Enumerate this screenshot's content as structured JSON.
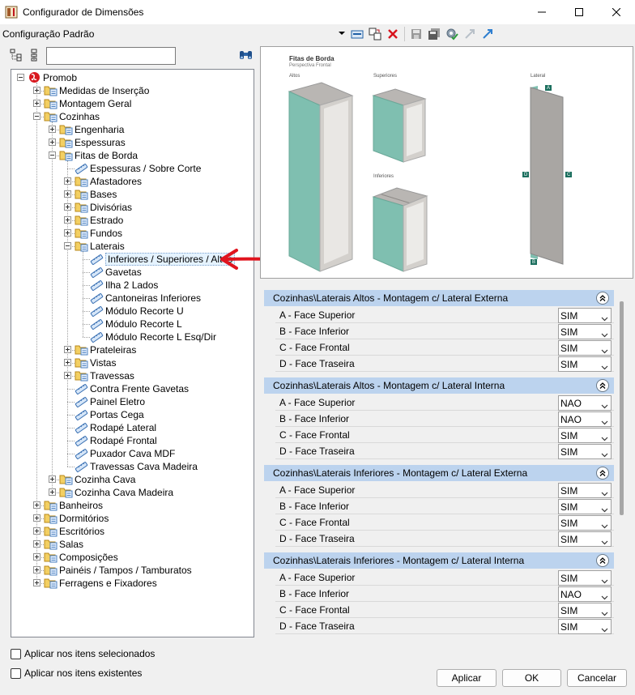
{
  "window": {
    "title": "Configurador de Dimensões"
  },
  "toolbar": {
    "config_value": "Configuração Padrão"
  },
  "tree": {
    "nodes": [
      {
        "label": "Promob",
        "level": 0,
        "expander": "minus",
        "icon": "globe-icon"
      },
      {
        "label": "Medidas de Inserção",
        "level": 1,
        "expander": "plus",
        "icon": "folder-icon"
      },
      {
        "label": "Montagem Geral",
        "level": 1,
        "expander": "plus",
        "icon": "folder-icon"
      },
      {
        "label": "Cozinhas",
        "level": 1,
        "expander": "minus",
        "icon": "folder-icon"
      },
      {
        "label": "Engenharia",
        "level": 2,
        "expander": "plus",
        "icon": "folder-icon"
      },
      {
        "label": "Espessuras",
        "level": 2,
        "expander": "plus",
        "icon": "folder-icon"
      },
      {
        "label": "Fitas de Borda",
        "level": 2,
        "expander": "minus",
        "icon": "folder-icon"
      },
      {
        "label": "Espessuras / Sobre Corte",
        "level": 3,
        "expander": "none",
        "icon": "ruler-icon"
      },
      {
        "label": "Afastadores",
        "level": 3,
        "expander": "plus",
        "icon": "folder-icon"
      },
      {
        "label": "Bases",
        "level": 3,
        "expander": "plus",
        "icon": "folder-icon"
      },
      {
        "label": "Divisórias",
        "level": 3,
        "expander": "plus",
        "icon": "folder-icon"
      },
      {
        "label": "Estrado",
        "level": 3,
        "expander": "plus",
        "icon": "folder-icon"
      },
      {
        "label": "Fundos",
        "level": 3,
        "expander": "plus",
        "icon": "folder-icon"
      },
      {
        "label": "Laterais",
        "level": 3,
        "expander": "minus",
        "icon": "folder-icon"
      },
      {
        "label": "Inferiores / Superiores / Altos",
        "level": 4,
        "expander": "none",
        "icon": "ruler-icon",
        "selected": true
      },
      {
        "label": "Gavetas",
        "level": 4,
        "expander": "none",
        "icon": "ruler-icon"
      },
      {
        "label": "Ilha 2 Lados",
        "level": 4,
        "expander": "none",
        "icon": "ruler-icon"
      },
      {
        "label": "Cantoneiras Inferiores",
        "level": 4,
        "expander": "none",
        "icon": "ruler-icon"
      },
      {
        "label": "Módulo Recorte U",
        "level": 4,
        "expander": "none",
        "icon": "ruler-icon"
      },
      {
        "label": "Módulo Recorte L",
        "level": 4,
        "expander": "none",
        "icon": "ruler-icon"
      },
      {
        "label": "Módulo Recorte L Esq/Dir",
        "level": 4,
        "expander": "none",
        "icon": "ruler-icon"
      },
      {
        "label": "Prateleiras",
        "level": 3,
        "expander": "plus",
        "icon": "folder-icon"
      },
      {
        "label": "Vistas",
        "level": 3,
        "expander": "plus",
        "icon": "folder-icon"
      },
      {
        "label": "Travessas",
        "level": 3,
        "expander": "plus",
        "icon": "folder-icon"
      },
      {
        "label": "Contra Frente Gavetas",
        "level": 3,
        "expander": "none",
        "icon": "ruler-icon"
      },
      {
        "label": "Painel Eletro",
        "level": 3,
        "expander": "none",
        "icon": "ruler-icon"
      },
      {
        "label": "Portas Cega",
        "level": 3,
        "expander": "none",
        "icon": "ruler-icon"
      },
      {
        "label": "Rodapé Lateral",
        "level": 3,
        "expander": "none",
        "icon": "ruler-icon"
      },
      {
        "label": "Rodapé Frontal",
        "level": 3,
        "expander": "none",
        "icon": "ruler-icon"
      },
      {
        "label": "Puxador Cava MDF",
        "level": 3,
        "expander": "none",
        "icon": "ruler-icon"
      },
      {
        "label": "Travessas Cava Madeira",
        "level": 3,
        "expander": "none",
        "icon": "ruler-icon"
      },
      {
        "label": "Cozinha Cava",
        "level": 2,
        "expander": "plus",
        "icon": "folder-icon"
      },
      {
        "label": "Cozinha Cava Madeira",
        "level": 2,
        "expander": "plus",
        "icon": "folder-icon"
      },
      {
        "label": "Banheiros",
        "level": 1,
        "expander": "plus",
        "icon": "folder-icon"
      },
      {
        "label": "Dormitórios",
        "level": 1,
        "expander": "plus",
        "icon": "folder-icon"
      },
      {
        "label": "Escritórios",
        "level": 1,
        "expander": "plus",
        "icon": "folder-icon"
      },
      {
        "label": "Salas",
        "level": 1,
        "expander": "plus",
        "icon": "folder-icon"
      },
      {
        "label": "Composições",
        "level": 1,
        "expander": "plus",
        "icon": "folder-icon"
      },
      {
        "label": "Painéis / Tampos / Tamburatos",
        "level": 1,
        "expander": "plus",
        "icon": "folder-icon"
      },
      {
        "label": "Ferragens e Fixadores",
        "level": 1,
        "expander": "plus",
        "icon": "folder-icon"
      }
    ]
  },
  "preview": {
    "title": "Fitas de Borda",
    "subtitle": "Perspectiva Frontal",
    "label_altos": "Altos",
    "label_superiores": "Superiores",
    "label_inferiores": "Inferiores",
    "label_lateral": "Lateral",
    "edge_a": "A",
    "edge_b": "B",
    "edge_c": "C",
    "edge_d": "D",
    "colors": {
      "edge_band": "#7fbfb0",
      "panel": "#c9c6c3",
      "badge": "#1b6f5e"
    }
  },
  "groups": [
    {
      "title": "Cozinhas\\Laterais Altos - Montagem c/ Lateral Externa",
      "rows": [
        {
          "label": "A - Face Superior",
          "value": "SIM"
        },
        {
          "label": "B - Face Inferior",
          "value": "SIM"
        },
        {
          "label": "C - Face Frontal",
          "value": "SIM"
        },
        {
          "label": "D - Face Traseira",
          "value": "SIM"
        }
      ]
    },
    {
      "title": "Cozinhas\\Laterais Altos - Montagem c/ Lateral Interna",
      "rows": [
        {
          "label": "A - Face Superior",
          "value": "NAO"
        },
        {
          "label": "B - Face Inferior",
          "value": "NAO"
        },
        {
          "label": "C - Face Frontal",
          "value": "SIM"
        },
        {
          "label": "D - Face Traseira",
          "value": "SIM"
        }
      ]
    },
    {
      "title": "Cozinhas\\Laterais Inferiores - Montagem c/ Lateral Externa",
      "rows": [
        {
          "label": "A - Face Superior",
          "value": "SIM"
        },
        {
          "label": "B - Face Inferior",
          "value": "SIM"
        },
        {
          "label": "C - Face Frontal",
          "value": "SIM"
        },
        {
          "label": "D - Face Traseira",
          "value": "SIM"
        }
      ]
    },
    {
      "title": "Cozinhas\\Laterais Inferiores - Montagem c/ Lateral Interna",
      "rows": [
        {
          "label": "A - Face Superior",
          "value": "SIM"
        },
        {
          "label": "B - Face Inferior",
          "value": "NAO"
        },
        {
          "label": "C - Face Frontal",
          "value": "SIM"
        },
        {
          "label": "D - Face Traseira",
          "value": "SIM"
        }
      ]
    }
  ],
  "options": {
    "apply_selected": "Aplicar nos itens selecionados",
    "apply_existing": "Aplicar nos itens existentes"
  },
  "buttons": {
    "apply": "Aplicar",
    "ok": "OK",
    "cancel": "Cancelar"
  },
  "colors": {
    "group_header": "#bcd3ee",
    "selection": "#e5f3ff",
    "annotation_arrow": "#e0141e"
  }
}
